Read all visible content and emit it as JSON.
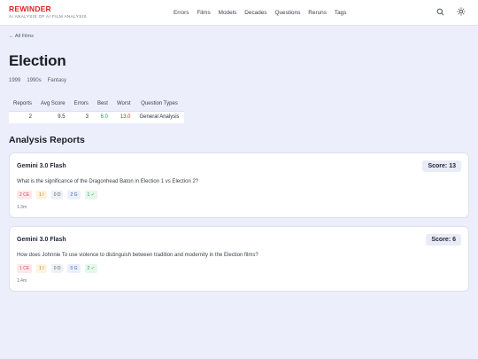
{
  "brand": {
    "name": "REWINDER",
    "tagline": "AI ANALYSIS OF AI FILM ANALYSIS"
  },
  "nav": [
    "Errors",
    "Films",
    "Models",
    "Decades",
    "Questions",
    "Reruns",
    "Tags"
  ],
  "icons": {
    "search": "search-icon",
    "theme": "sun-icon"
  },
  "back_link": "← All Films",
  "film": {
    "title": "Election",
    "year": "1999",
    "decade": "1990s",
    "genre": "Fantasy"
  },
  "stats": {
    "headers": [
      "Reports",
      "Avg Score",
      "Errors",
      "Best",
      "Worst",
      "Question Types"
    ],
    "values": [
      "2",
      "9.5",
      "3",
      "6.0",
      "13.0",
      "General Analysis"
    ]
  },
  "section_title": "Analysis Reports",
  "reports": [
    {
      "model": "Gemini 3.0 Flash",
      "score": "Score: 13",
      "question": "What is the significance of the Dragonhead Baton in Election 1 vs Election 2?",
      "badges": {
        "ce": "2 CE",
        "i": "1 I",
        "d": "0 D",
        "g": "2 G",
        "ok": "1 ✓"
      },
      "time": "1.3m"
    },
    {
      "model": "Gemini 3.0 Flash",
      "score": "Score: 6",
      "question": "How does Johnnie To use violence to distinguish between tradition and modernity in the Election films?",
      "badges": {
        "ce": "1 CE",
        "i": "1 I",
        "d": "0 D",
        "g": "0 G",
        "ok": "2 ✓"
      },
      "time": "1.4m"
    }
  ],
  "colors": {
    "brand": "#e02424",
    "best": "#16a34a",
    "worst": "#dc2626",
    "background": "#eceffb"
  }
}
